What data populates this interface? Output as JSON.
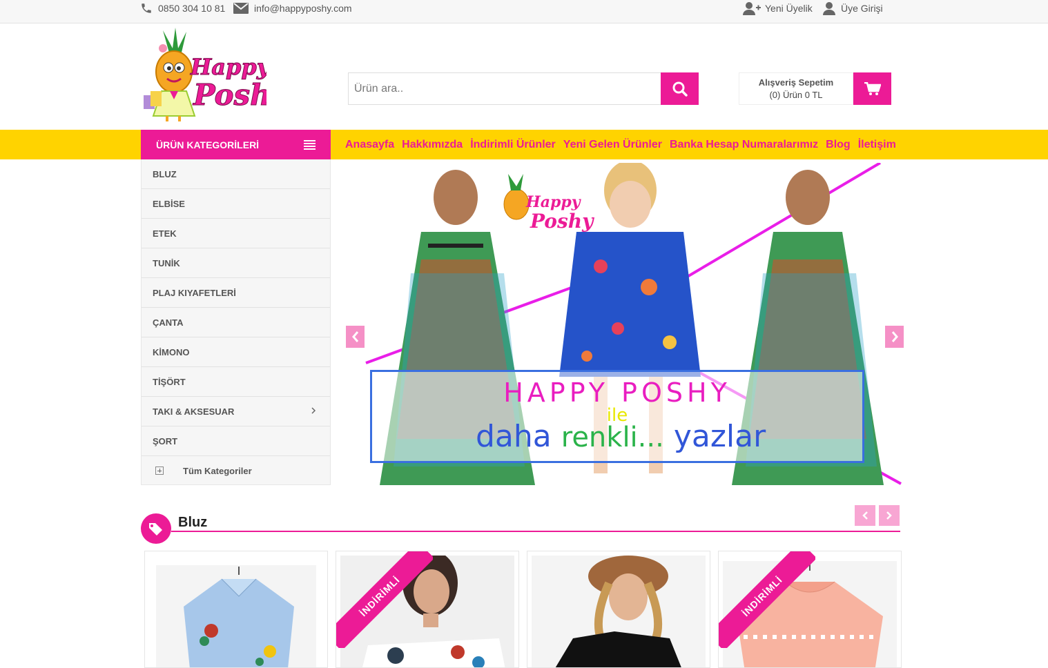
{
  "topbar": {
    "phone": "0850 304 10 81",
    "email": "info@happyposhy.com",
    "register": "Yeni Üyelik",
    "login": "Üye Girişi"
  },
  "header": {
    "logo_text_1": "Happy",
    "logo_text_2": "Poshy",
    "search_placeholder": "Ürün ara..",
    "cart_title": "Alışveriş Sepetim",
    "cart_summary": "(0) Ürün 0 TL"
  },
  "nav": {
    "categories_label": "ÜRÜN KATEGORİLERİ",
    "menu": [
      "Anasayfa",
      "Hakkımızda",
      "İndirimli Ürünler",
      "Yeni Gelen Ürünler",
      "Banka Hesap Numaralarımız",
      "Blog",
      "İletişim"
    ]
  },
  "sidebar": {
    "items": [
      "BLUZ",
      "ELBİSE",
      "ETEK",
      "TUNİK",
      "PLAJ KIYAFETLERİ",
      "ÇANTA",
      "KİMONO",
      "TİŞÖRT",
      "TAKI & AKSESUAR",
      "ŞORT"
    ],
    "all_label": "Tüm Kategoriler"
  },
  "banner": {
    "line1": "HAPPY POSHY",
    "line2": "ile",
    "line3a": "daha",
    "line3b": "renkli...",
    "line3c": "yazlar",
    "logo_1": "Happy",
    "logo_2": "Poshy"
  },
  "section": {
    "title": "Bluz"
  },
  "products": {
    "ribbon_label": "İNDİRİMLİ"
  },
  "colors": {
    "brand_pink": "#ec1b96",
    "nav_yellow": "#ffd300"
  },
  "icons": [
    "phone-icon",
    "envelope-icon",
    "user-plus-icon",
    "user-icon",
    "search-icon",
    "cart-icon",
    "menu-icon",
    "chevron-right-icon",
    "plus-square-icon",
    "chevron-left-icon",
    "tag-icon"
  ]
}
